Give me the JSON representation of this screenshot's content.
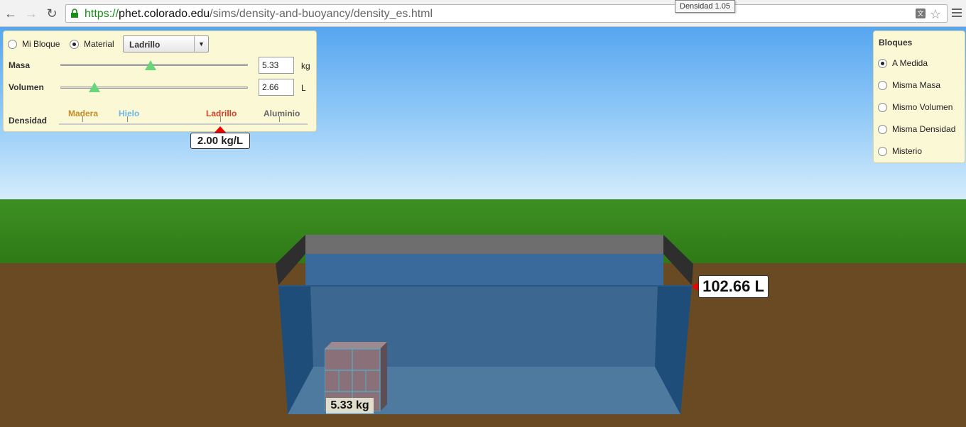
{
  "browser": {
    "url_scheme": "https://",
    "url_host": "phet.colorado.edu",
    "url_path": "/sims/density-and-buoyancy/density_es.html",
    "tooltip": "Densidad 1.05"
  },
  "controls": {
    "mode_custom": "Mi Bloque",
    "mode_material": "Material",
    "selected_mode": "material",
    "material_selected": "Ladrillo",
    "mass_label": "Masa",
    "mass_value": "5.33",
    "mass_unit": "kg",
    "mass_slider_fraction": 0.48,
    "volume_label": "Volumen",
    "volume_value": "2.66",
    "volume_unit": "L",
    "volume_slider_fraction": 0.18,
    "density_label": "Densidad",
    "density_materials": [
      {
        "name": "Madera",
        "color": "#c78b2a"
      },
      {
        "name": "Hielo",
        "color": "#6fb6e6"
      },
      {
        "name": "Ladrillo",
        "color": "#d2402a"
      },
      {
        "name": "Aluminio",
        "color": "#666666"
      }
    ],
    "density_readout": "2.00 kg/L"
  },
  "blocks_panel": {
    "title": "Bloques",
    "options": [
      "A Medida",
      "Misma Masa",
      "Mismo Volumen",
      "Misma Densidad",
      "Misterio"
    ],
    "selected_index": 0
  },
  "scene": {
    "block_mass_label": "5.33 kg",
    "water_volume_label": "102.66 L"
  },
  "colors": {
    "panel_bg": "#fbf8d6",
    "water": "#2f6fa8",
    "ground": "#694a22",
    "grass": "#3c8f22"
  }
}
